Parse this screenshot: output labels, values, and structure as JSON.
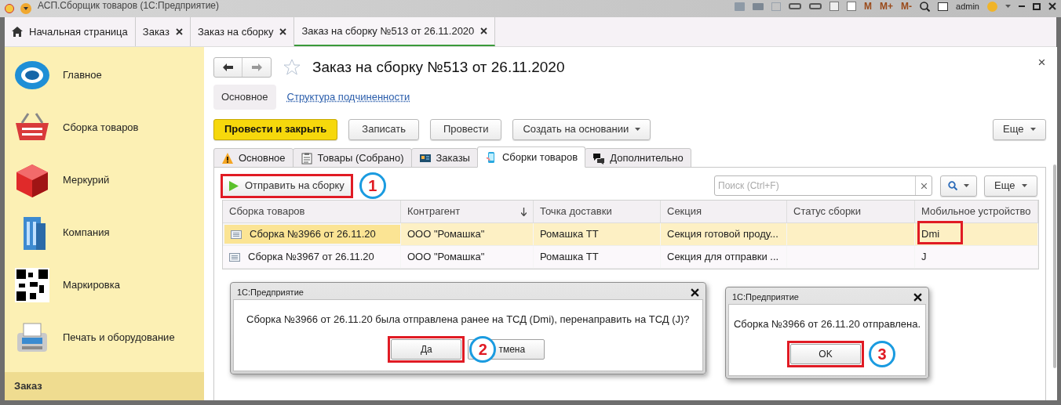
{
  "title_bar": {
    "title": "АСП.Сборщик товаров (1С:Предприятие)",
    "user": "admin",
    "memory_buttons": [
      "M",
      "M+",
      "M-"
    ]
  },
  "tabs": [
    {
      "label": "Начальная страница",
      "home": true,
      "closable": false,
      "selected": false
    },
    {
      "label": "Заказ",
      "home": false,
      "closable": true,
      "selected": false
    },
    {
      "label": "Заказ на сборку",
      "home": false,
      "closable": true,
      "selected": false
    },
    {
      "label": "Заказ на сборку №513 от 26.11.2020",
      "home": false,
      "closable": true,
      "selected": true
    }
  ],
  "sidebar": {
    "items": [
      {
        "label": "Главное",
        "kind": "globe"
      },
      {
        "label": "Сборка товаров",
        "kind": "basket"
      },
      {
        "label": "Меркурий",
        "kind": "cube"
      },
      {
        "label": "Компания",
        "kind": "building"
      },
      {
        "label": "Маркировка",
        "kind": "qr"
      },
      {
        "label": "Печать и оборудование",
        "kind": "terminal"
      }
    ],
    "footer": "Заказ"
  },
  "document": {
    "title": "Заказ на сборку №513 от 26.11.2020",
    "close": "×",
    "sections": [
      {
        "label": "Основное",
        "selected": true
      },
      {
        "label": "Структура подчиненности",
        "selected": false
      }
    ],
    "commands": [
      {
        "label": "Провести и закрыть",
        "kind": "primary"
      },
      {
        "label": "Записать",
        "kind": "normal"
      },
      {
        "label": "Провести",
        "kind": "normal"
      },
      {
        "label": "Создать на основании",
        "kind": "dropdown"
      }
    ],
    "more": "Еще",
    "form_tabs": [
      {
        "label": "Основное",
        "kind": "warning",
        "selected": false
      },
      {
        "label": "Товары (Собрано)",
        "kind": "clipboard",
        "selected": false
      },
      {
        "label": "Заказы",
        "kind": "card",
        "selected": false
      },
      {
        "label": "Сборки товаров",
        "kind": "phone",
        "selected": true
      },
      {
        "label": "Дополнительно",
        "kind": "chat",
        "selected": false
      }
    ],
    "table_toolbar": {
      "send_button": "Отправить на сборку",
      "send_annotation": "1",
      "search_placeholder": "Поиск (Ctrl+F)",
      "more": "Еще"
    },
    "columns": [
      {
        "label": "Сборка товаров",
        "sorted": false
      },
      {
        "label": "Контрагент",
        "sorted": true
      },
      {
        "label": "Точка доставки",
        "sorted": false
      },
      {
        "label": "Секция",
        "sorted": false
      },
      {
        "label": "Статус сборки",
        "sorted": false
      },
      {
        "label": "Мобильное устройство",
        "sorted": false
      }
    ],
    "rows": [
      {
        "selected": true,
        "highlight_device": true,
        "cells": [
          "Сборка №3966 от 26.11.20",
          "ООО \"Ромашка\"",
          "Ромашка ТТ",
          "Секция готовой проду...",
          "",
          "Dmi"
        ]
      },
      {
        "selected": false,
        "highlight_device": false,
        "cells": [
          "Сборка №3967 от 26.11.20",
          "ООО \"Ромашка\"",
          "Ромашка ТТ",
          "Секция для отправки ...",
          "",
          "J"
        ]
      }
    ]
  },
  "dialogs": [
    {
      "title": "1С:Предприятие",
      "message": "Сборка №3966 от 26.11.20 была отправлена ранее на ТСД (Dmi), перенаправить на ТСД (J)?",
      "buttons": [
        {
          "label": "Да",
          "annotation": "2"
        },
        {
          "label": "тмена"
        }
      ]
    },
    {
      "title": "1С:Предприятие",
      "message": "Сборка №3966 от 26.11.20 отправлена.",
      "buttons": [
        {
          "label": "OK",
          "annotation": "3"
        }
      ]
    }
  ]
}
